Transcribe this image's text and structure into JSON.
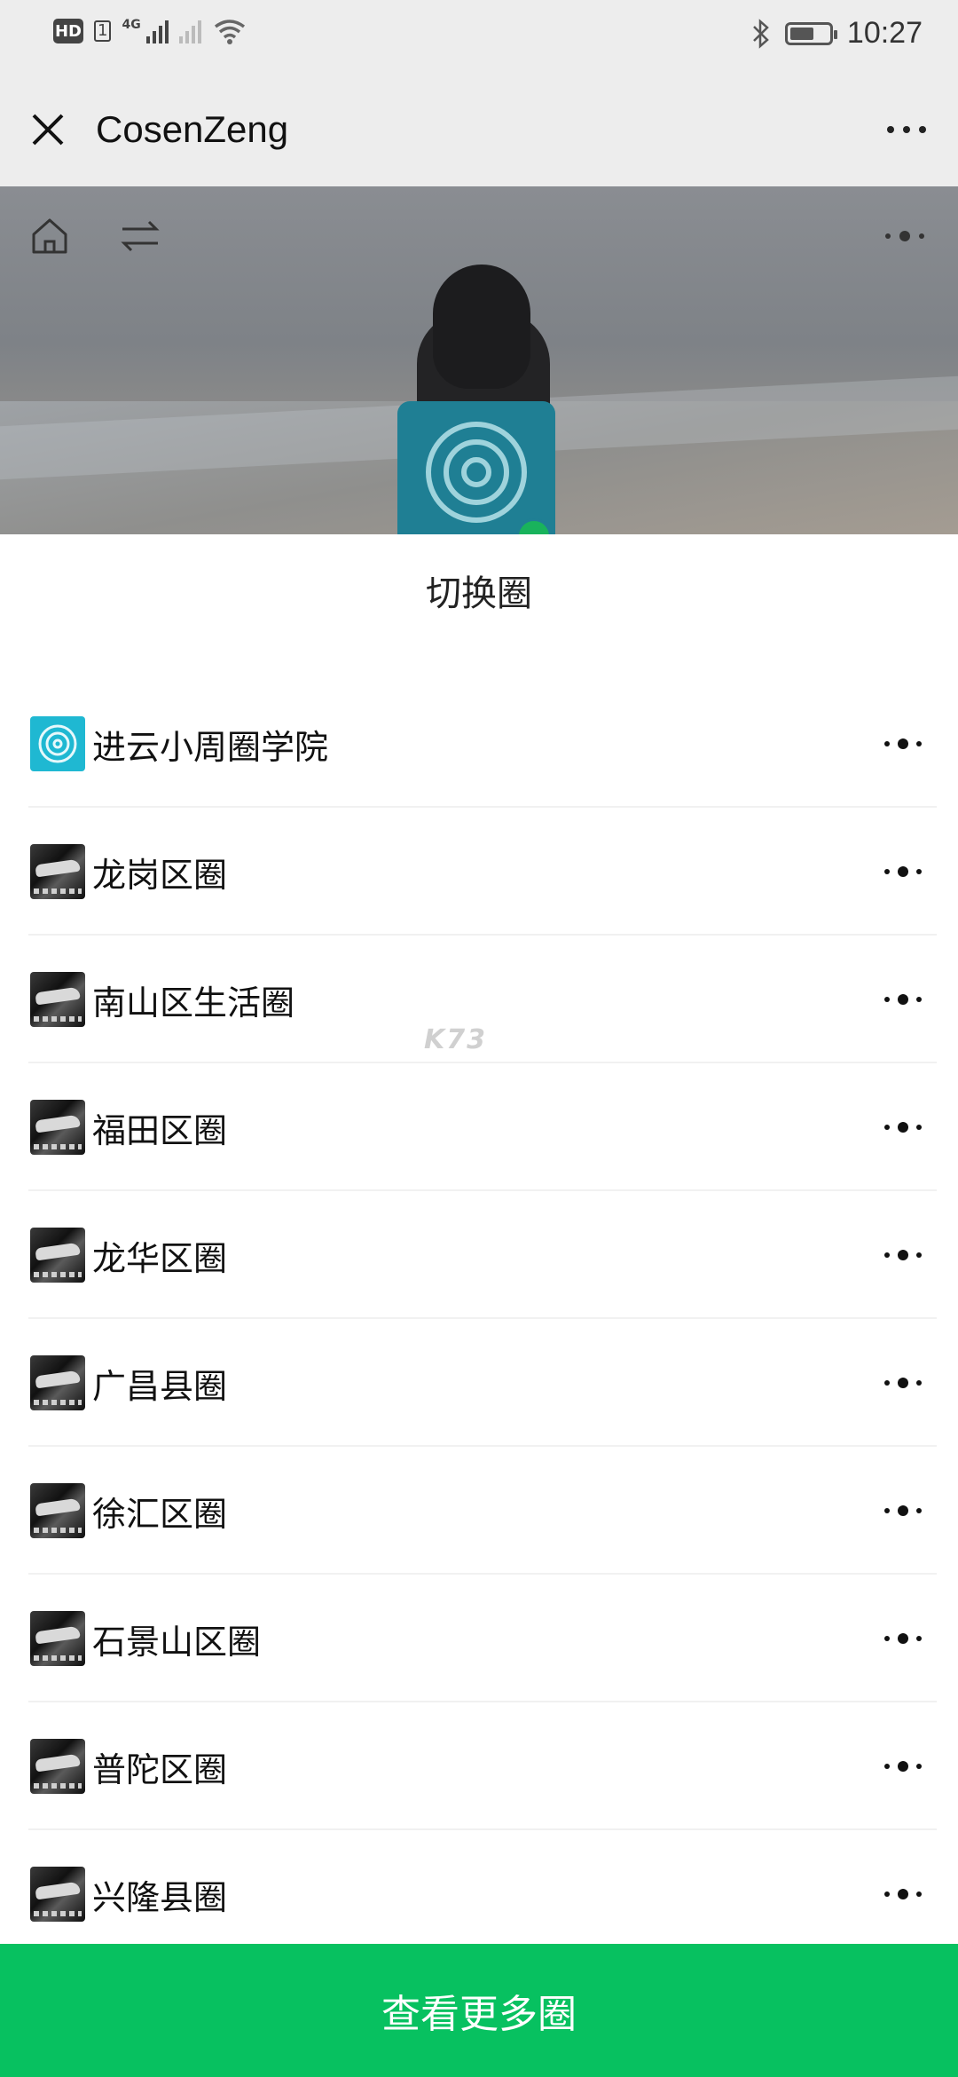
{
  "status_bar": {
    "hd_label": "HD",
    "sim_label": "1",
    "network_type": "4G",
    "time": "10:27",
    "battery_level": 0.55
  },
  "title_bar": {
    "title": "CosenZeng",
    "close_icon": "close-icon",
    "more_icon": "more-icon"
  },
  "hero": {
    "home_icon": "home-icon",
    "switch_icon": "switch-arrows-icon",
    "more_icon": "more-dots-icon"
  },
  "sheet": {
    "title": "切换圈",
    "items": [
      {
        "label": "进云小周圈学院",
        "icon": "circle-logo-icon"
      },
      {
        "label": "龙岗区圈",
        "icon": "car-photo-icon"
      },
      {
        "label": "南山区生活圈",
        "icon": "car-photo-icon"
      },
      {
        "label": "福田区圈",
        "icon": "car-photo-icon"
      },
      {
        "label": "龙华区圈",
        "icon": "car-photo-icon"
      },
      {
        "label": "广昌县圈",
        "icon": "car-photo-icon"
      },
      {
        "label": "徐汇区圈",
        "icon": "car-photo-icon"
      },
      {
        "label": "石景山区圈",
        "icon": "car-photo-icon"
      },
      {
        "label": "普陀区圈",
        "icon": "car-photo-icon"
      },
      {
        "label": "兴隆县圈",
        "icon": "car-photo-icon"
      }
    ],
    "watermark": "K73"
  },
  "bottom_button": {
    "label": "查看更多圈"
  },
  "colors": {
    "accent_green": "#07c160",
    "header_bg": "#ededed",
    "circle_icon_bg": "#1fb8d2"
  }
}
